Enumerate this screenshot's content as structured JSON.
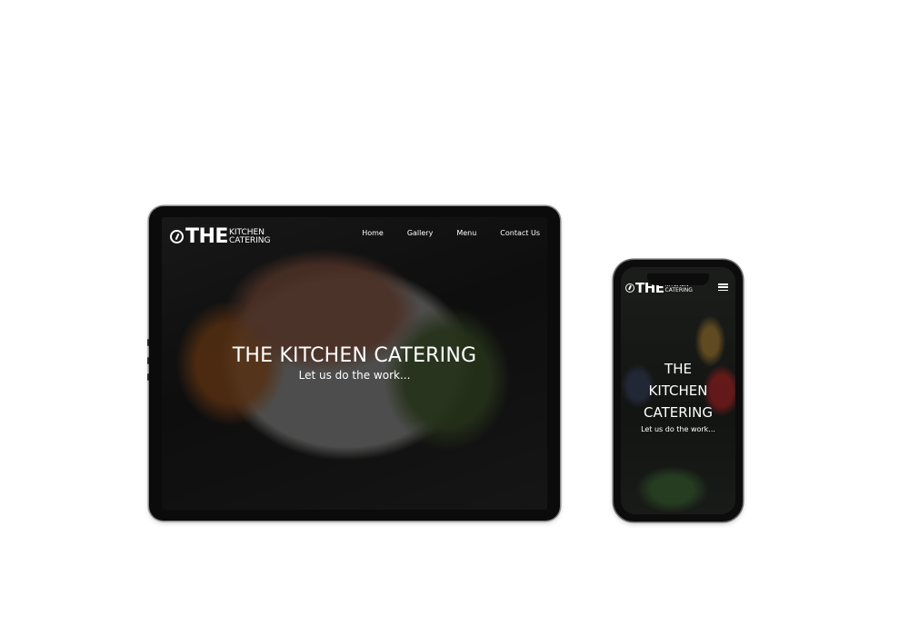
{
  "brand": {
    "the": "THE",
    "kitchen": "KITCHEN",
    "catering": "CATERING"
  },
  "nav": {
    "items": [
      "Home",
      "Gallery",
      "Menu",
      "Contact Us"
    ]
  },
  "hero": {
    "title": "THE KITCHEN CATERING",
    "subtitle": "Let us do the work..."
  },
  "phone_hero": {
    "line1": "THE",
    "line2": "KITCHEN",
    "line3": "CATERING",
    "subtitle": "Let us do the work..."
  },
  "icons": {
    "logo": "chef-hat-icon",
    "menu": "hamburger-menu-icon"
  },
  "colors": {
    "text": "#ffffff",
    "device": "#0b0b0c"
  }
}
